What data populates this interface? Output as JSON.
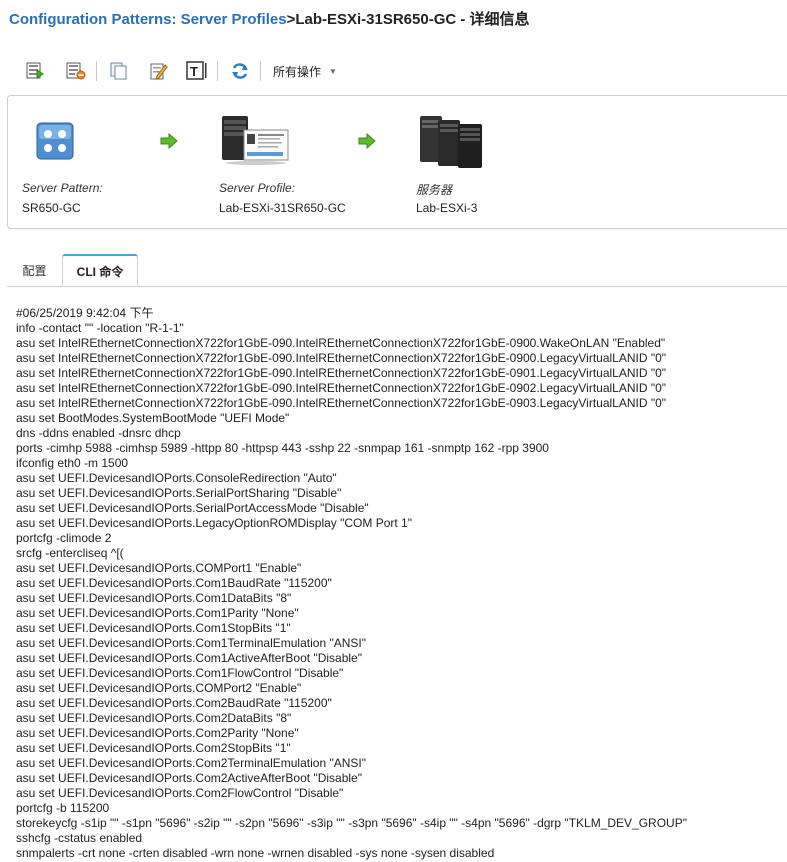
{
  "header": {
    "breadcrumb": "Configuration Patterns: Server Profiles",
    "title_rest": ">Lab-ESXi-31SR650-GC - 详细信息"
  },
  "toolbar": {
    "actions_menu_label": "所有操作",
    "icons": [
      "deploy-icon",
      "unassign-icon",
      "copy-icon",
      "edit-icon",
      "text-icon",
      "refresh-icon"
    ]
  },
  "flow": {
    "pattern": {
      "label": "Server Pattern:",
      "value": "SR650-GC"
    },
    "profile": {
      "label": "Server Profile:",
      "value": "Lab-ESXi-31SR650-GC"
    },
    "server": {
      "label": "服务器",
      "value": "Lab-ESXi-3"
    }
  },
  "tabs": [
    {
      "label": "配置",
      "active": false
    },
    {
      "label": "CLI 命令",
      "active": true
    }
  ],
  "cli_lines": [
    "#06/25/2019 9:42:04 下午",
    "info -contact \"\" -location \"R-1-1\"",
    "asu set IntelREthernetConnectionX722for1GbE-090.IntelREthernetConnectionX722for1GbE-0900.WakeOnLAN \"Enabled\"",
    "asu set IntelREthernetConnectionX722for1GbE-090.IntelREthernetConnectionX722for1GbE-0900.LegacyVirtualLANID \"0\"",
    "asu set IntelREthernetConnectionX722for1GbE-090.IntelREthernetConnectionX722for1GbE-0901.LegacyVirtualLANID \"0\"",
    "asu set IntelREthernetConnectionX722for1GbE-090.IntelREthernetConnectionX722for1GbE-0902.LegacyVirtualLANID \"0\"",
    "asu set IntelREthernetConnectionX722for1GbE-090.IntelREthernetConnectionX722for1GbE-0903.LegacyVirtualLANID \"0\"",
    "asu set BootModes.SystemBootMode \"UEFI Mode\"",
    "dns -ddns enabled -dnsrc dhcp",
    "ports -cimhp 5988 -cimhsp 5989 -httpp 80 -httpsp 443 -sshp 22 -snmpap 161 -snmptp 162 -rpp 3900",
    "ifconfig eth0 -m 1500",
    "asu set UEFI.DevicesandIOPorts.ConsoleRedirection \"Auto\"",
    "asu set UEFI.DevicesandIOPorts.SerialPortSharing \"Disable\"",
    "asu set UEFI.DevicesandIOPorts.SerialPortAccessMode \"Disable\"",
    "asu set UEFI.DevicesandIOPorts.LegacyOptionROMDisplay \"COM Port 1\"",
    "portcfg -climode 2",
    "srcfg -entercliseq ^[(",
    "asu set UEFI.DevicesandIOPorts.COMPort1 \"Enable\"",
    "asu set UEFI.DevicesandIOPorts.Com1BaudRate \"115200\"",
    "asu set UEFI.DevicesandIOPorts.Com1DataBits \"8\"",
    "asu set UEFI.DevicesandIOPorts.Com1Parity \"None\"",
    "asu set UEFI.DevicesandIOPorts.Com1StopBits \"1\"",
    "asu set UEFI.DevicesandIOPorts.Com1TerminalEmulation \"ANSI\"",
    "asu set UEFI.DevicesandIOPorts.Com1ActiveAfterBoot \"Disable\"",
    "asu set UEFI.DevicesandIOPorts.Com1FlowControl \"Disable\"",
    "asu set UEFI.DevicesandIOPorts.COMPort2 \"Enable\"",
    "asu set UEFI.DevicesandIOPorts.Com2BaudRate \"115200\"",
    "asu set UEFI.DevicesandIOPorts.Com2DataBits \"8\"",
    "asu set UEFI.DevicesandIOPorts.Com2Parity \"None\"",
    "asu set UEFI.DevicesandIOPorts.Com2StopBits \"1\"",
    "asu set UEFI.DevicesandIOPorts.Com2TerminalEmulation \"ANSI\"",
    "asu set UEFI.DevicesandIOPorts.Com2ActiveAfterBoot \"Disable\"",
    "asu set UEFI.DevicesandIOPorts.Com2FlowControl \"Disable\"",
    "portcfg -b 115200",
    "storekeycfg -s1ip \"\" -s1pn \"5696\" -s2ip \"\" -s2pn \"5696\" -s3ip \"\" -s3pn \"5696\" -s4ip \"\" -s4pn \"5696\" -dgrp \"TKLM_DEV_GROUP\"",
    "sshcfg -cstatus enabled",
    "snmpalerts -crt none -crten disabled -wrn none -wrnen disabled -sys none -sysen disabled"
  ]
}
